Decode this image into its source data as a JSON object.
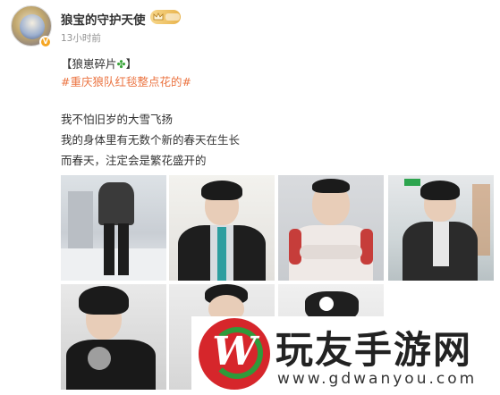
{
  "post": {
    "username": "狼宝的守护天使",
    "verified_badge": "V",
    "time": "13小时前",
    "lines": {
      "title_open": "【狼崽碎片",
      "title_close": "】",
      "topic": "#重庆狼队红毯整点花的#",
      "body1": "我不怕旧岁的大雪飞扬",
      "body2": "我的身体里有无数个新的春天在生长",
      "body3": "而春天，注定会是繁花盛开的"
    },
    "photos_count": 7
  },
  "watermark": {
    "logo_letter": "W",
    "title": "玩友手游网",
    "url": "www.gdwanyou.com"
  },
  "colors": {
    "topic": "#eb7340",
    "badge": "#f5a623",
    "watermark_red": "#d6262b",
    "watermark_green": "#2f9a3a"
  },
  "icons": {
    "clover": "four-leaf-clover",
    "crown": "crown-membership-badge"
  }
}
